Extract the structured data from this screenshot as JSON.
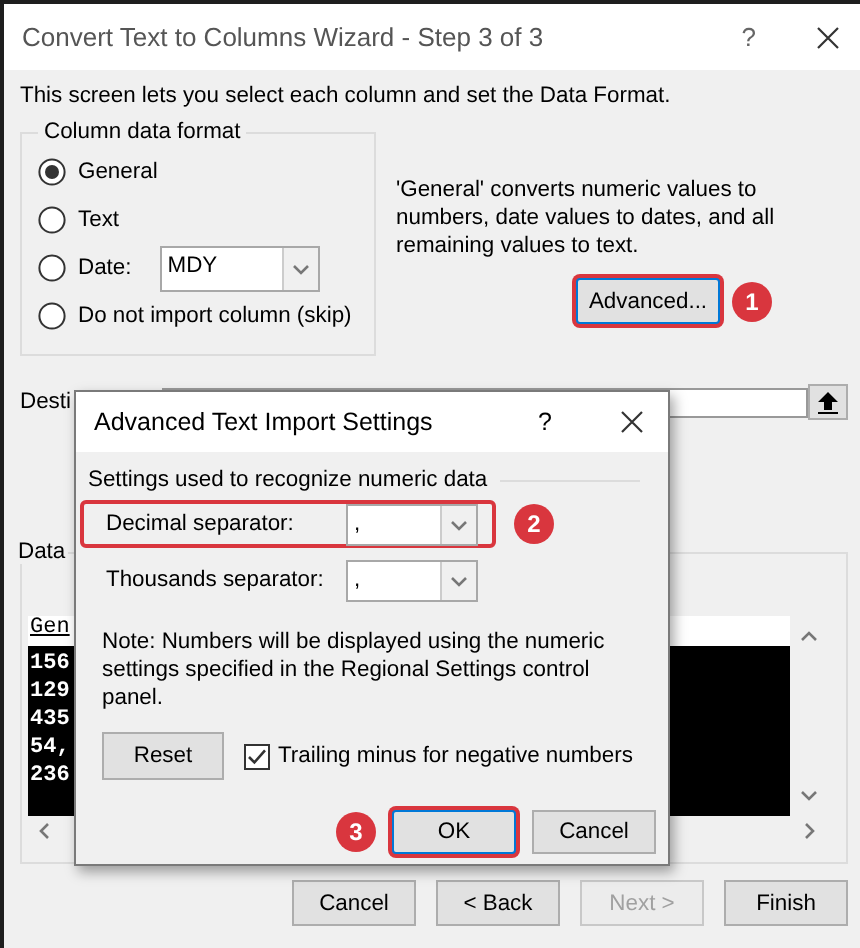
{
  "window": {
    "title": "Convert Text to Columns Wizard - Step 3 of 3",
    "help": "?"
  },
  "intro": "This screen lets you select each column and set the Data Format.",
  "column_data_format": {
    "title": "Column data format",
    "options": [
      {
        "kind": "radio",
        "label": "General",
        "selected": true
      },
      {
        "kind": "radio",
        "label": "Text",
        "selected": false
      },
      {
        "kind": "date",
        "label": "Date:",
        "selected": false,
        "value": "MDY"
      },
      {
        "kind": "radio",
        "label": "Do not import column (skip)",
        "selected": false
      }
    ]
  },
  "description": "'General' converts numeric values to numbers, date values to dates, and all remaining values to text.",
  "advanced_button": {
    "label": "Advanced...",
    "highlighted": true,
    "callout": "1"
  },
  "destination": {
    "label": "Desti"
  },
  "data_preview": {
    "title": "Data",
    "header": "Gen",
    "rows": [
      "156",
      "129",
      "435",
      "54,",
      "236"
    ]
  },
  "buttons": [
    {
      "label": "Cancel",
      "disabled": false
    },
    {
      "label": "< Back",
      "disabled": false
    },
    {
      "label": "Next >",
      "disabled": true
    },
    {
      "label": "Finish",
      "disabled": false
    }
  ],
  "dialog": {
    "title": "Advanced Text Import Settings",
    "help": "?",
    "section": "Settings used to recognize numeric data",
    "fields": [
      {
        "label": "Decimal separator:",
        "value": ",",
        "highlighted": true,
        "callout": "2"
      },
      {
        "label": "Thousands separator:",
        "value": ",",
        "highlighted": false
      }
    ],
    "note": "Note: Numbers will be displayed using the numeric settings specified in the Regional Settings control panel.",
    "reset_button": "Reset",
    "trailing_minus": {
      "label": "Trailing minus for negative numbers",
      "checked": true
    },
    "buttons": [
      {
        "label": "OK",
        "highlighted": true,
        "callout": "3"
      },
      {
        "label": "Cancel",
        "highlighted": false
      }
    ]
  }
}
